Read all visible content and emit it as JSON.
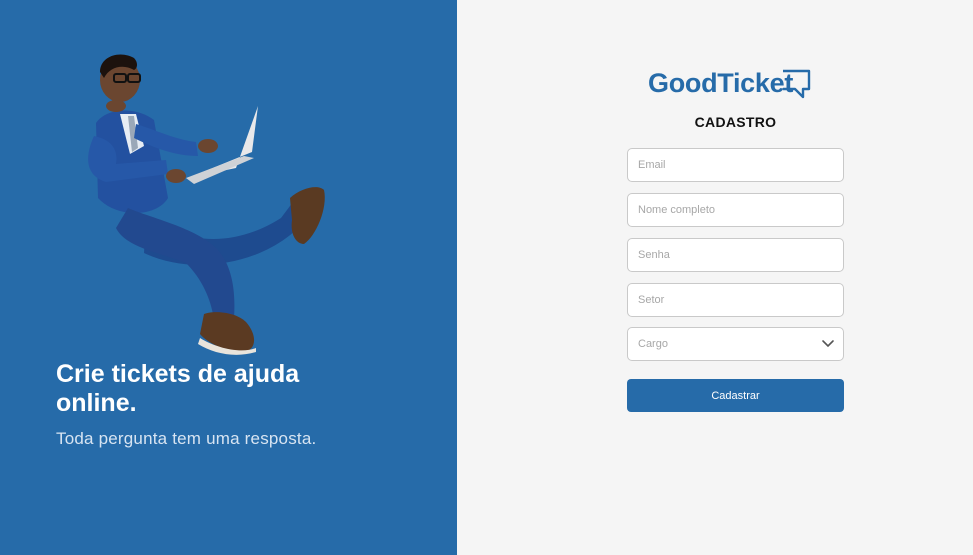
{
  "hero": {
    "title": "Crie tickets de ajuda online.",
    "subtitle": "Toda pergunta tem uma resposta."
  },
  "brand": {
    "logo_text": "GoodTicket",
    "logo_icon": "speech-bubble-icon",
    "color": "#266ba9"
  },
  "form": {
    "title": "CADASTRO",
    "email_placeholder": "Email",
    "name_placeholder": "Nome completo",
    "password_placeholder": "Senha",
    "sector_placeholder": "Setor",
    "role_placeholder": "Cargo",
    "submit_label": "Cadastrar"
  },
  "colors": {
    "left_panel": "#266ba9",
    "right_panel": "#f5f5f5",
    "button": "#266ba9"
  }
}
